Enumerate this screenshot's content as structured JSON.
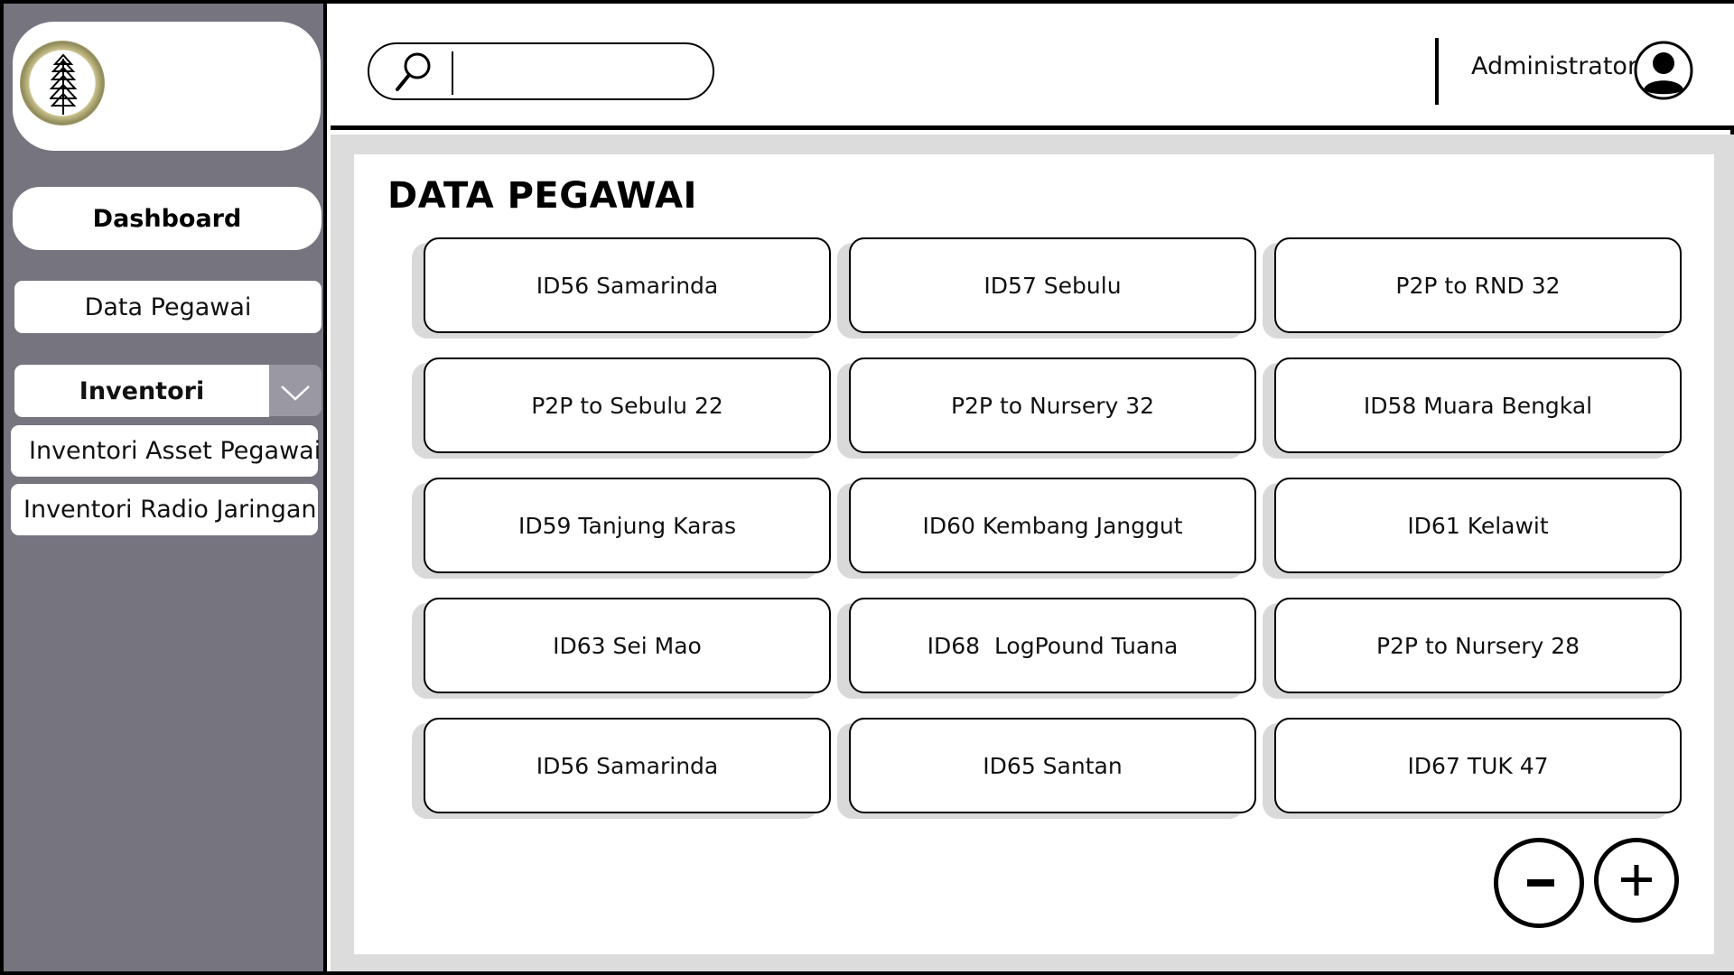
{
  "sidebar": {
    "logo_icon": "pine-tree-logo-icon",
    "dashboard_label": "Dashboard",
    "data_pegawai_label": "Data Pegawai",
    "inventori_label": "Inventori",
    "dropdown_icon": "chevron-down-icon",
    "submenu": [
      {
        "label": "Inventori Asset Pegawai"
      },
      {
        "label": "Inventori Radio Jaringan"
      }
    ]
  },
  "header": {
    "search_placeholder": "",
    "search_icon": "search-icon",
    "user_label": "Administrator",
    "avatar_icon": "user-avatar-icon"
  },
  "main": {
    "title": "DATA PEGAWAI",
    "locations": [
      {
        "label": "ID56 Samarinda"
      },
      {
        "label": "ID57 Sebulu"
      },
      {
        "label": "P2P to RND 32"
      },
      {
        "label": "P2P to Sebulu 22"
      },
      {
        "label": "P2P to Nursery 32"
      },
      {
        "label": "ID58 Muara Bengkal"
      },
      {
        "label": "ID59 Tanjung Karas"
      },
      {
        "label": "ID60 Kembang Janggut"
      },
      {
        "label": "ID61 Kelawit"
      },
      {
        "label": "ID63 Sei Mao"
      },
      {
        "label": "ID68  LogPound Tuana"
      },
      {
        "label": "P2P to Nursery 28"
      },
      {
        "label": "ID56 Samarinda"
      },
      {
        "label": "ID65 Santan"
      },
      {
        "label": "ID67 TUK 47"
      }
    ],
    "minus_icon": "minus-icon",
    "plus_icon": "plus-icon"
  },
  "colors": {
    "sidebar_bg": "#76747f",
    "dropdown_bg": "#9a99a3",
    "main_bg": "#dcdcdc",
    "card_shadow": "#d9d9d9"
  }
}
